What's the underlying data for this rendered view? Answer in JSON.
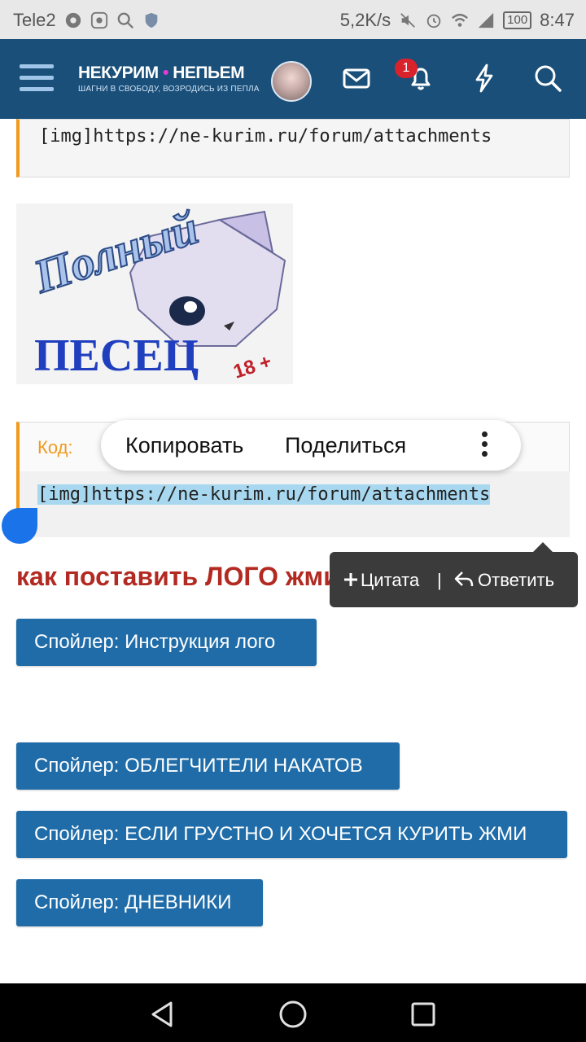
{
  "status_bar": {
    "carrier": "Tele2",
    "speed": "5,2K/s",
    "battery": "100",
    "time": "8:47"
  },
  "header": {
    "logo_title_part1": "НЕКУРИМ",
    "logo_dot": "•",
    "logo_title_part2": "НЕПЬЕМ",
    "logo_subtitle": "ШАГНИ В СВОБОДУ, ВОЗРОДИСЬ ИЗ ПЕПЛА",
    "notification_count": "1"
  },
  "post": {
    "code_top": "[img]https://ne-kurim.ru/forum/attachments",
    "image_caption_line1": "Полный",
    "image_caption_line2": "ПЕСЕЦ",
    "image_stamp": "18 +",
    "code_label": "Код:",
    "code_selected": "[img]https://ne-kurim.ru/forum/attachments",
    "heading": "как поставить ЛОГО жми",
    "spoilers": [
      "Спойлер: Инструкция лого",
      "Спойлер: ОБЛЕГЧИТЕЛИ НАКАТОВ",
      "Спойлер: ЕСЛИ ГРУСТНО И ХОЧЕТСЯ КУРИТЬ ЖМИ",
      "Спойлер: ДНЕВНИКИ"
    ]
  },
  "context_menu": {
    "copy": "Копировать",
    "share": "Поделиться"
  },
  "quote_tooltip": {
    "quote": "Цитата",
    "separator": "|",
    "reply": "Ответить"
  },
  "colors": {
    "header_bg": "#1a4f79",
    "spoiler_bg": "#1f6ca8",
    "accent_orange": "#f19a1e",
    "heading_red": "#b22a22",
    "selection": "#a8d8f0"
  }
}
